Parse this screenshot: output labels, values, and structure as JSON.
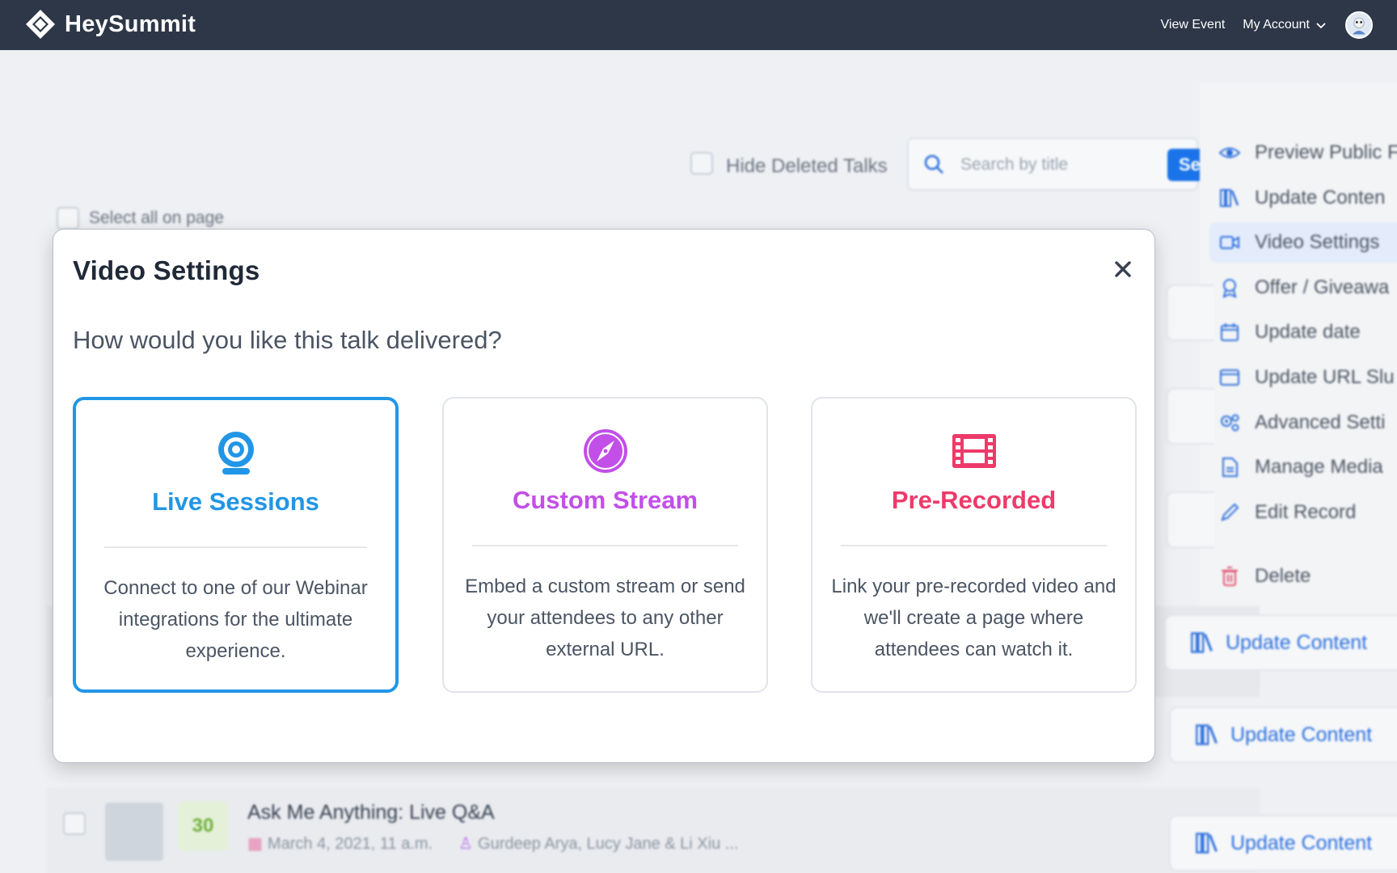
{
  "app": {
    "name": "HeySummit",
    "nav": {
      "view_event": "View Event",
      "my_account": "My Account"
    }
  },
  "background": {
    "hide_deleted_label": "Hide Deleted Talks",
    "search_placeholder": "Search by title",
    "search_button": "Se",
    "select_all_label": "Select all on page",
    "side_menu": [
      {
        "label": "Preview Public F",
        "icon": "eye-icon"
      },
      {
        "label": "Update Conten",
        "icon": "books-icon"
      },
      {
        "label": "Video Settings",
        "icon": "video-icon"
      },
      {
        "label": "Offer / Giveawa",
        "icon": "award-icon"
      },
      {
        "label": "Update date",
        "icon": "calendar-icon"
      },
      {
        "label": "Update URL Slu",
        "icon": "browser-icon"
      },
      {
        "label": "Advanced Setti",
        "icon": "gears-icon"
      },
      {
        "label": "Manage Media",
        "icon": "file-icon"
      },
      {
        "label": "Edit Record",
        "icon": "pencil-icon"
      },
      {
        "label": "Delete",
        "icon": "trash-icon"
      }
    ],
    "update_content_label": "Update Content",
    "talk": {
      "score": "30",
      "title": "Ask Me Anything: Live Q&A",
      "date": "March 4, 2021, 11 a.m.",
      "speakers": "Gurdeep Arya, Lucy Jane & Li Xiu ..."
    }
  },
  "modal": {
    "title": "Video Settings",
    "question": "How would you like this talk delivered?",
    "options": [
      {
        "title": "Live Sessions",
        "description": "Connect to one of our Webinar integrations for the ultimate experience.",
        "color": "#2196e6",
        "icon": "webcam-icon",
        "selected": true
      },
      {
        "title": "Custom Stream",
        "description": "Embed a custom stream or send your attendees to any other external URL.",
        "color": "#c24fe8",
        "icon": "compass-icon",
        "selected": false
      },
      {
        "title": "Pre-Recorded",
        "description": "Link your pre-recorded video and we'll create a page where attendees can watch it.",
        "color": "#ee3a6a",
        "icon": "film-icon",
        "selected": false
      }
    ]
  }
}
